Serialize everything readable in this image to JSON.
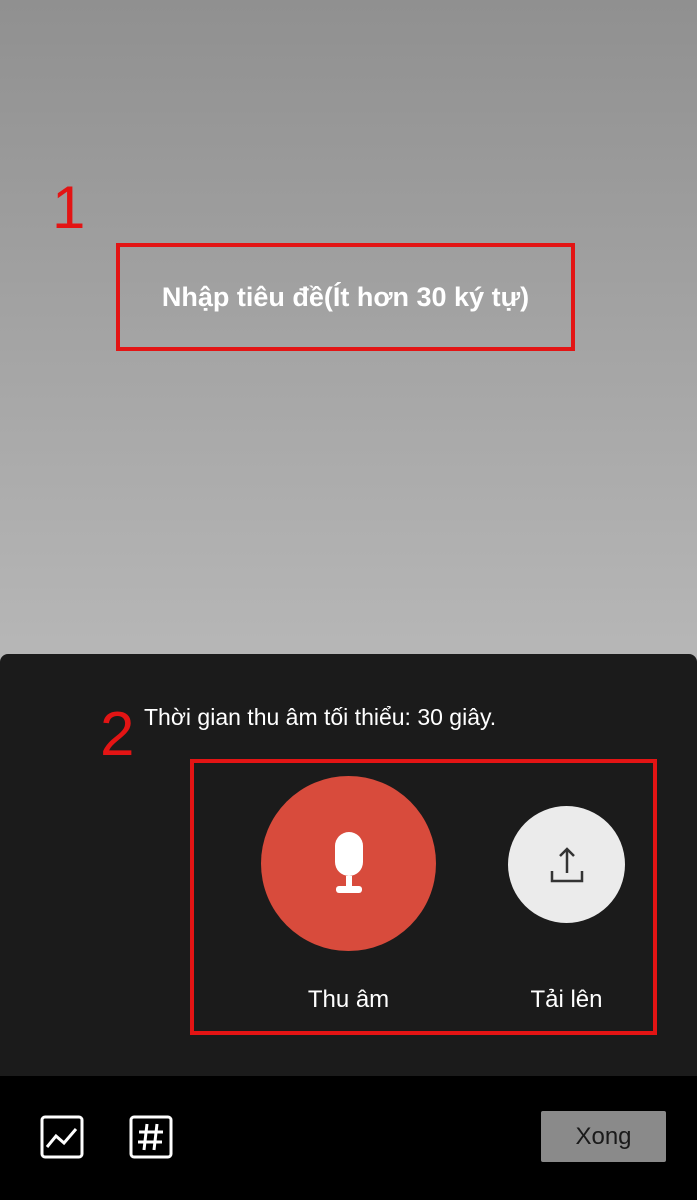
{
  "annotations": {
    "step1": "1",
    "step2": "2"
  },
  "title_input": {
    "placeholder": "Nhập tiêu đề(Ít hơn 30 ký tự)"
  },
  "recorder": {
    "hint": "Thời gian thu âm tối thiểu: 30 giây.",
    "record_label": "Thu âm",
    "upload_label": "Tải lên",
    "record_icon": "microphone-icon",
    "upload_icon": "upload-icon"
  },
  "toolbar": {
    "image_icon": "image-icon",
    "hashtag_icon": "hashtag-icon",
    "done_label": "Xong"
  },
  "colors": {
    "annotation_red": "#e31414",
    "record_button": "#d84b3c",
    "upload_button": "#ebebeb",
    "sheet_background": "#1b1b1b",
    "toolbar_background": "#000000",
    "done_button": "#8a8a8a"
  }
}
